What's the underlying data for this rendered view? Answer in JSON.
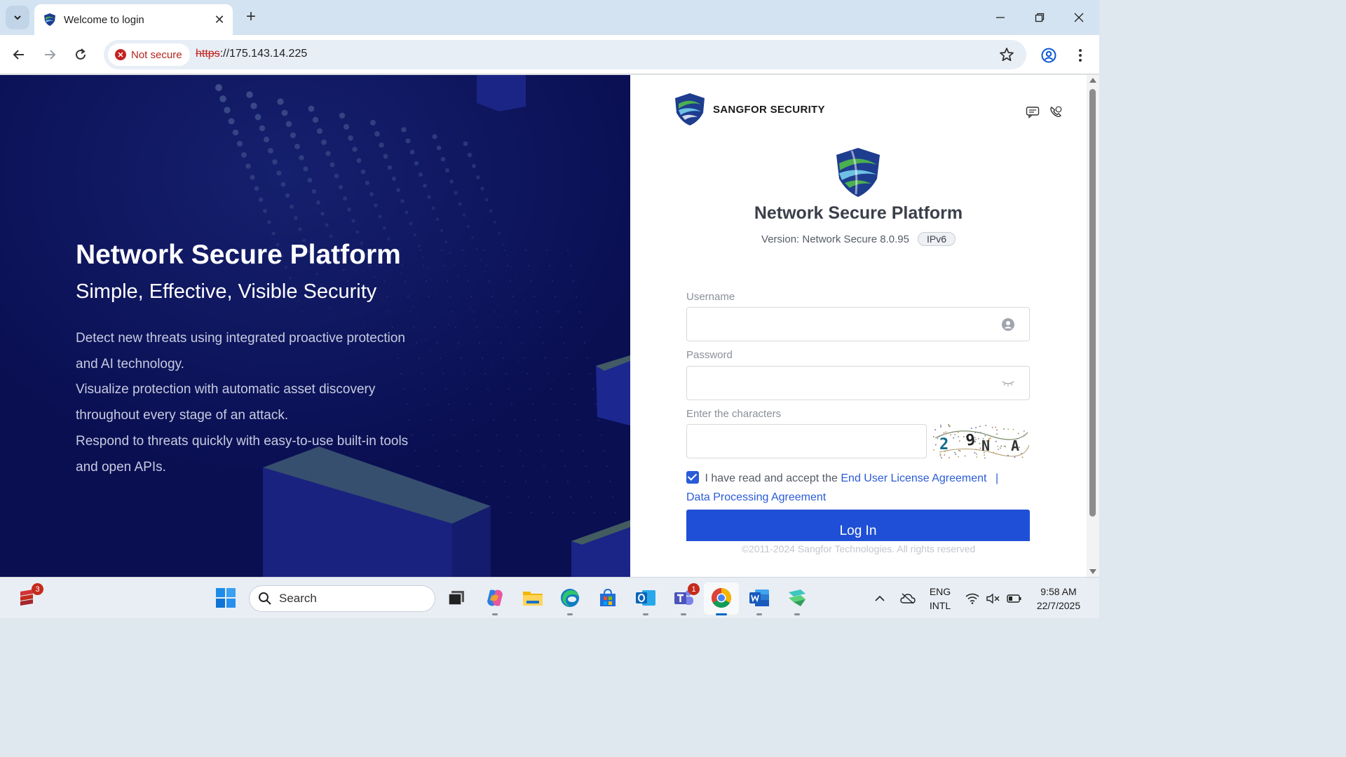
{
  "browser": {
    "tab_title": "Welcome to login",
    "security_label": "Not secure",
    "url_scheme": "https",
    "url_rest": "://175.143.14.225"
  },
  "hero": {
    "title": "Network Secure Platform",
    "subtitle": "Simple, Effective, Visible Security",
    "lines": [
      "Detect new threats using integrated proactive protection",
      "and AI technology.",
      "Visualize protection with automatic asset discovery",
      "throughout every stage of an attack.",
      "Respond to threats quickly with easy-to-use built-in tools",
      "and open APIs."
    ]
  },
  "login": {
    "brand": "SANGFOR  SECURITY",
    "title": "Network Secure Platform",
    "version": "Version: Network Secure 8.0.95",
    "ipv6_badge": "IPv6",
    "username_label": "Username",
    "username_value": "",
    "password_label": "Password",
    "password_value": "",
    "captcha_label": "Enter the characters",
    "captcha_value": "",
    "captcha_text": "2 9 N A",
    "agree_checked": true,
    "agree_text": "I have read and accept the",
    "eula_link": "End User License Agreement",
    "separator": "|",
    "dpa_link": "Data Processing Agreement",
    "login_button": "Log In",
    "copyright": "©2011-2024 Sangfor Technologies. All rights reserved"
  },
  "taskbar": {
    "search_placeholder": "Search",
    "badge_left": "3",
    "teams_badge": "1",
    "lang_line1": "ENG",
    "lang_line2": "INTL",
    "time": "9:58 AM",
    "date": "22/7/2025"
  },
  "colors": {
    "hero_bg": "#0a0f52",
    "primary": "#1f4fd6",
    "link": "#2a5bd7",
    "danger": "#c5221f"
  }
}
